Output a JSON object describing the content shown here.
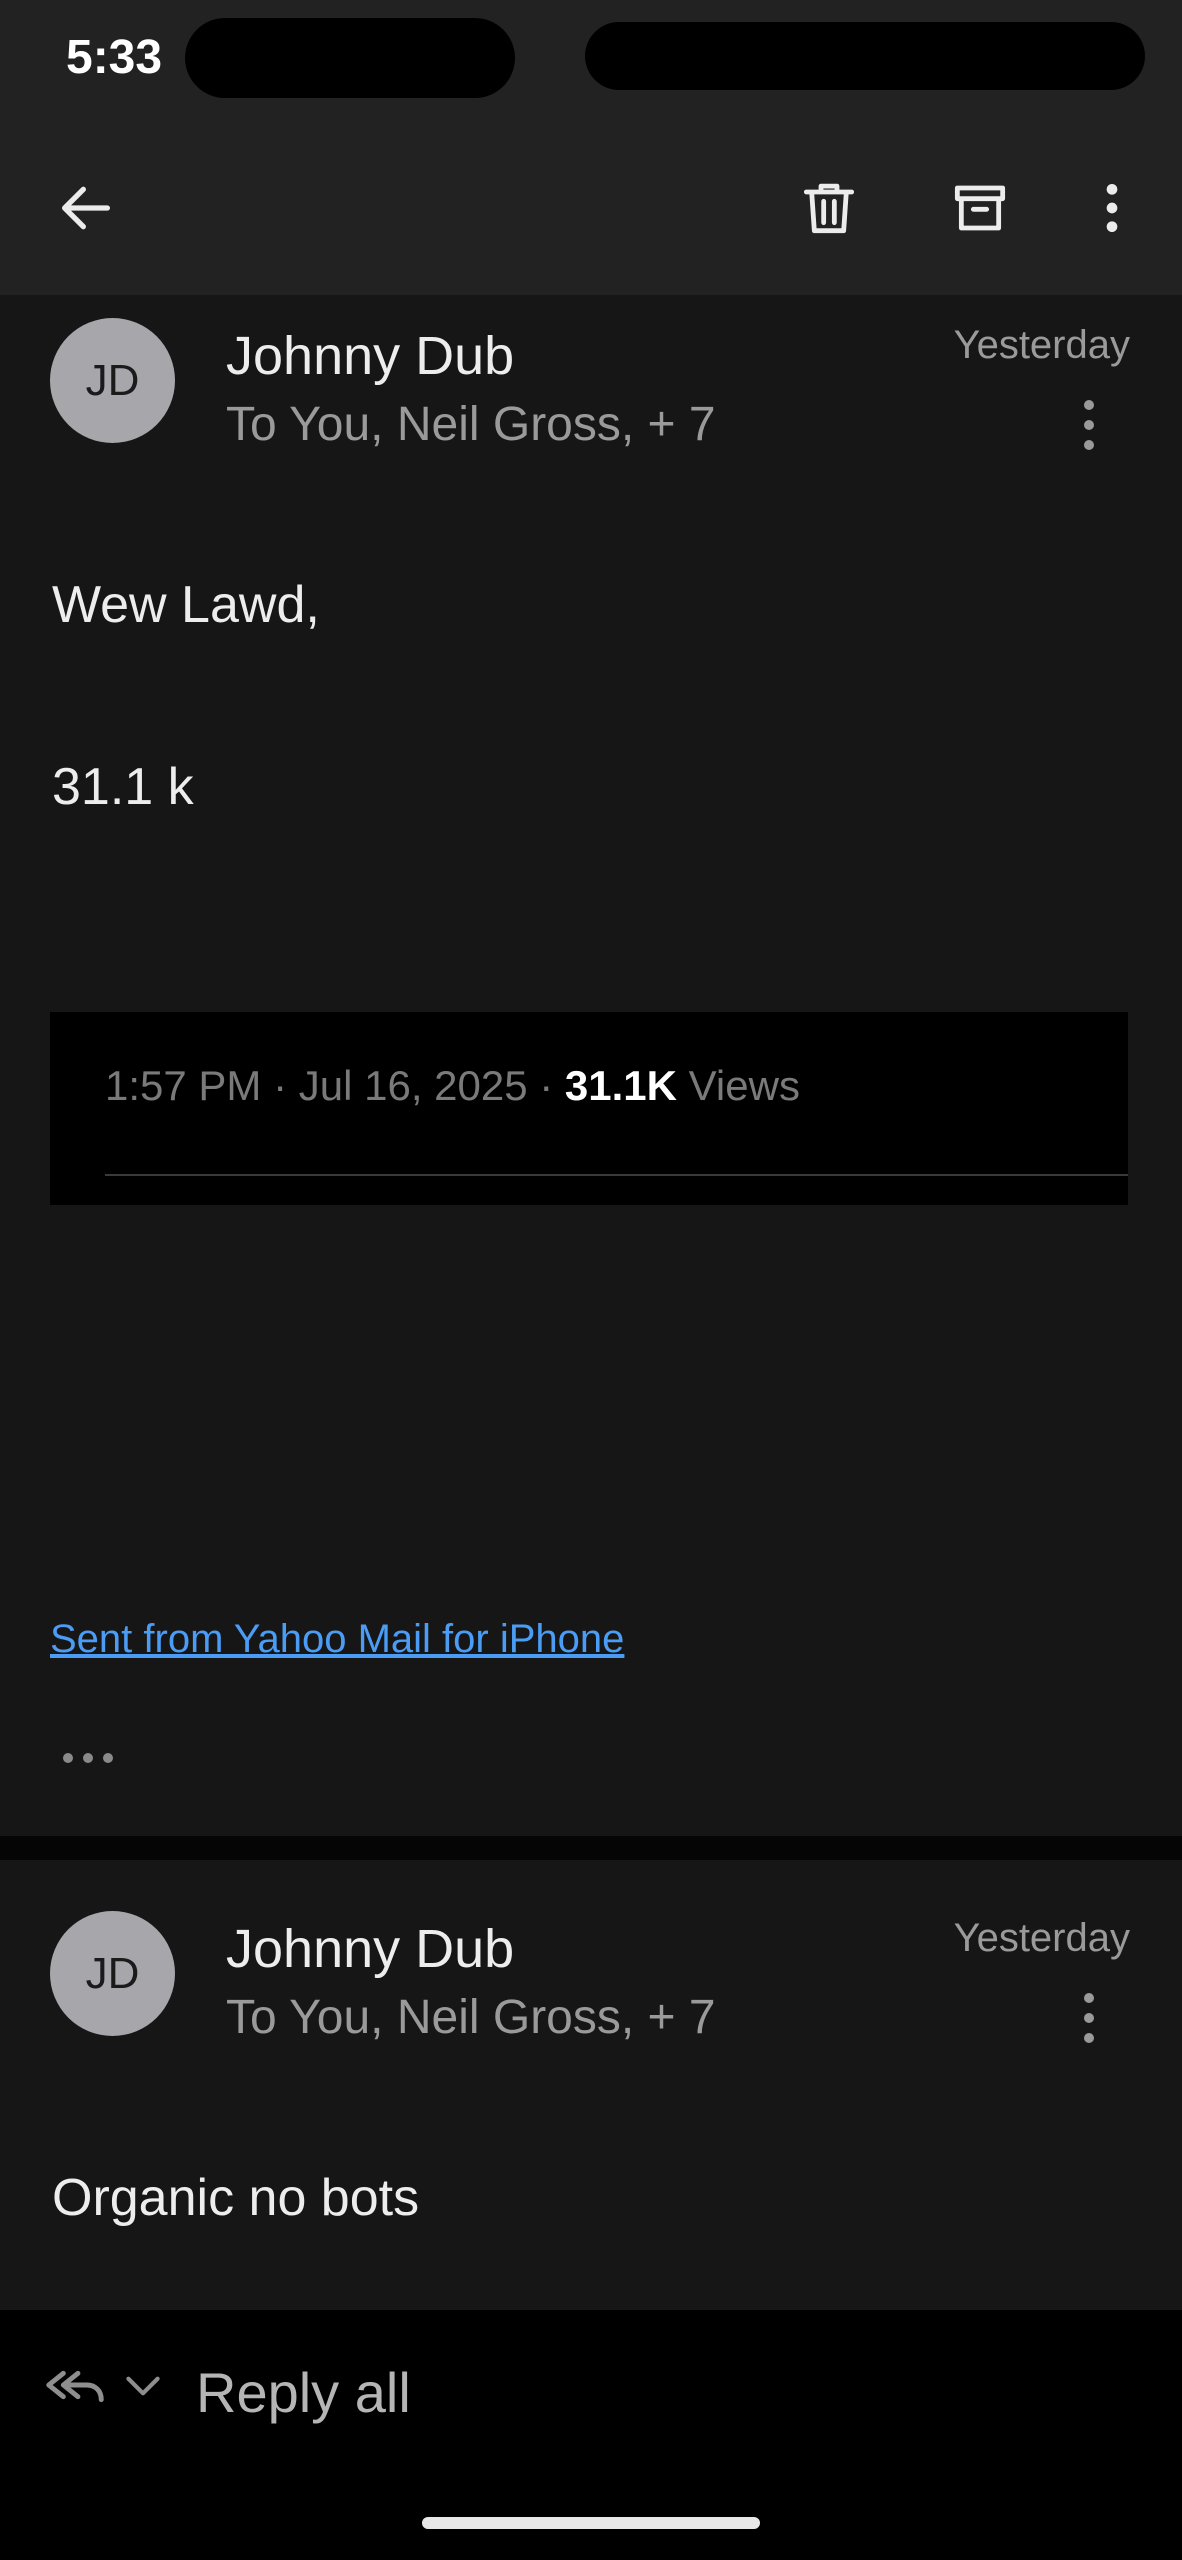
{
  "status_bar": {
    "time": "5:33"
  },
  "toolbar": {
    "back_icon": "arrow-left-icon",
    "delete_icon": "trash-icon",
    "archive_icon": "archive-icon",
    "more_icon": "kebab-icon"
  },
  "messages": [
    {
      "avatar_initials": "JD",
      "sender": "Johnny Dub",
      "recipients": "To You, Neil Gross, + 7",
      "date": "Yesterday",
      "greeting": "Wew Lawd,",
      "line2": "31.1 k",
      "embed": {
        "time_date": "1:57 PM · Jul 16, 2025 · ",
        "views_count": "31.1K",
        "views_label": " Views"
      },
      "signature": "Sent from Yahoo Mail for iPhone"
    },
    {
      "avatar_initials": "JD",
      "sender": "Johnny Dub",
      "recipients": "To You, Neil Gross, + 7",
      "date": "Yesterday",
      "body": "Organic no bots"
    }
  ],
  "reply_bar": {
    "label": "Reply all"
  },
  "colors": {
    "background": "#161616",
    "toolbar": "#222222",
    "link": "#4a9cf5",
    "avatar": "#a6a6ab"
  }
}
